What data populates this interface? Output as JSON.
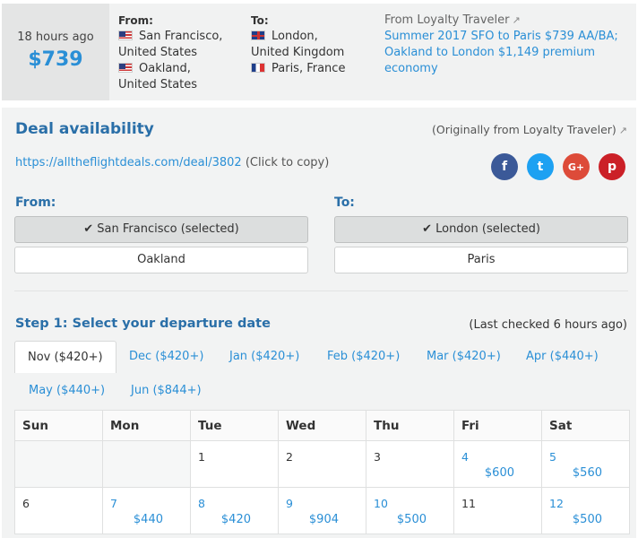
{
  "summary": {
    "ago": "18 hours ago",
    "price": "$739",
    "from_heading": "From:",
    "from_cities": [
      {
        "flag": "us-flag-icon",
        "line1": "San Francisco,",
        "line2": "United States"
      },
      {
        "flag": "us-flag-icon",
        "line1": "Oakland,",
        "line2": "United States"
      }
    ],
    "to_heading": "To:",
    "to_cities": [
      {
        "flag": "uk-flag-icon",
        "line1": "London,",
        "line2": "United Kingdom"
      },
      {
        "flag": "france-flag-icon",
        "line1": "Paris, France",
        "line2": ""
      }
    ],
    "source_title": "From Loyalty Traveler",
    "source_links": [
      "Summer 2017 SFO to Paris $739 AA/BA;",
      "Oakland to London $1,149 premium",
      "economy"
    ]
  },
  "panel": {
    "title": "Deal availability",
    "orig_note": "(Originally from Loyalty Traveler)",
    "url": "https://alltheflightdeals.com/deal/3802",
    "url_hint": "(Click to copy)",
    "social": [
      {
        "name": "facebook",
        "glyph": "f",
        "color": "#3b5998"
      },
      {
        "name": "twitter",
        "glyph": "t",
        "color": "#1da1f2"
      },
      {
        "name": "google-plus",
        "glyph": "G+",
        "color": "#dd4b39"
      },
      {
        "name": "pinterest",
        "glyph": "p",
        "color": "#cb2027"
      }
    ],
    "from_label": "From:",
    "to_label": "To:",
    "from_options": [
      "✔ San Francisco (selected)",
      "Oakland"
    ],
    "to_options": [
      "✔ London (selected)",
      "Paris"
    ],
    "step1": "Step 1: Select your departure date",
    "last_checked": "(Last checked 6 hours ago)",
    "months": [
      "Nov ($420+)",
      "Dec ($420+)",
      "Jan ($420+)",
      "Feb ($420+)",
      "Mar ($420+)",
      "Apr ($440+)",
      "May ($440+)",
      "Jun ($844+)"
    ],
    "active_month": 0
  },
  "calendar": {
    "headers": [
      "Sun",
      "Mon",
      "Tue",
      "Wed",
      "Thu",
      "Fri",
      "Sat"
    ],
    "rows": [
      [
        {
          "d": ""
        },
        {
          "d": ""
        },
        {
          "d": "1"
        },
        {
          "d": "2"
        },
        {
          "d": "3"
        },
        {
          "d": "4",
          "p": "$600"
        },
        {
          "d": "5",
          "p": "$560"
        }
      ],
      [
        {
          "d": "6"
        },
        {
          "d": "7",
          "p": "$440"
        },
        {
          "d": "8",
          "p": "$420"
        },
        {
          "d": "9",
          "p": "$904"
        },
        {
          "d": "10",
          "p": "$500"
        },
        {
          "d": "11"
        },
        {
          "d": "12",
          "p": "$500"
        }
      ]
    ]
  }
}
